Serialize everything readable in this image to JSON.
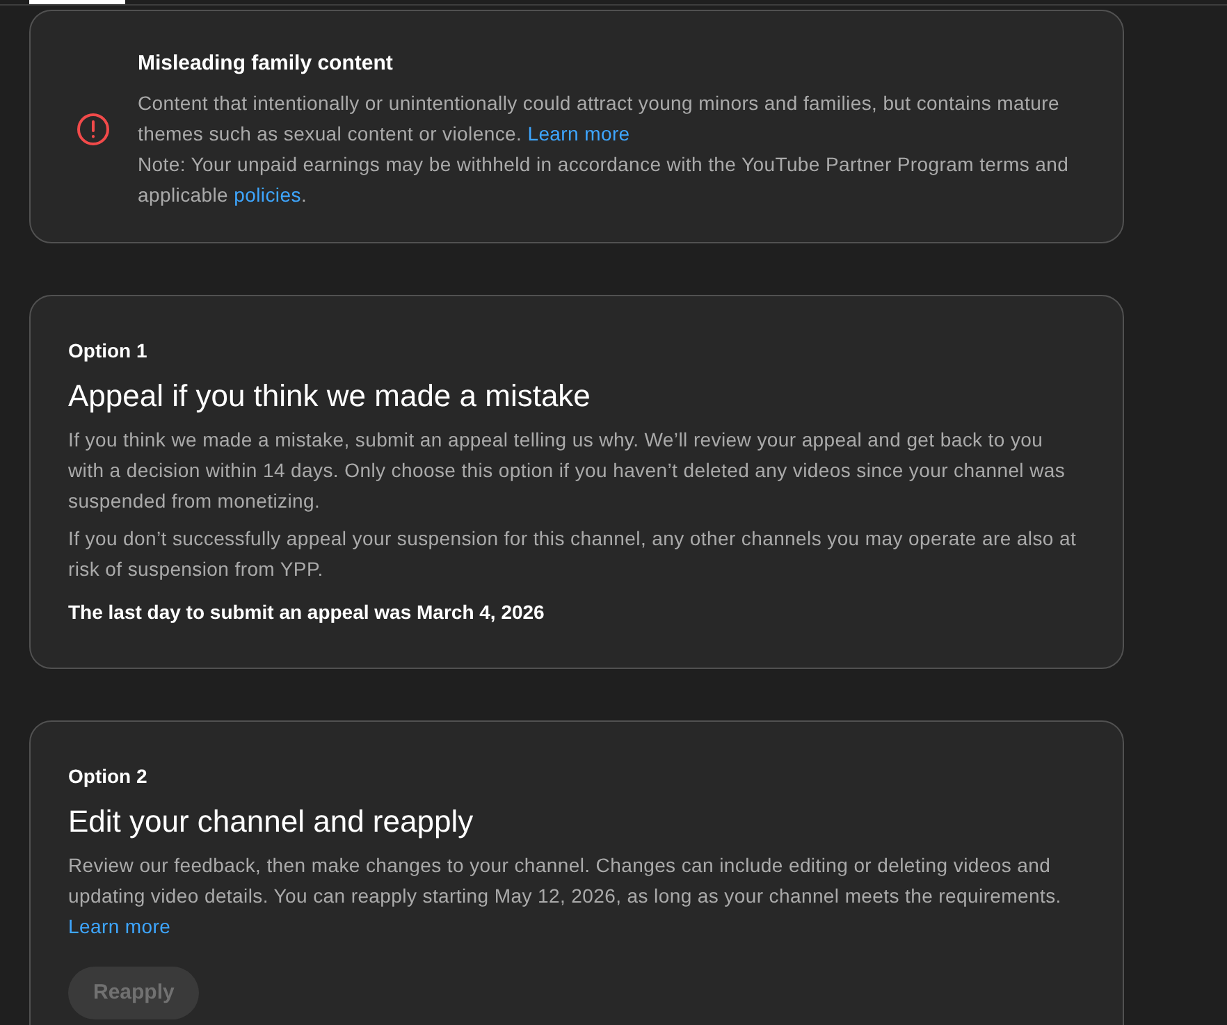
{
  "policy": {
    "title": "Misleading family content",
    "paragraphs": [
      [
        {
          "kind": "text",
          "text": "Content that intentionally or unintentionally could attract young minors and families, but contains mature themes such as sexual content or violence. "
        },
        {
          "kind": "link",
          "text": "Learn more"
        }
      ],
      [
        {
          "kind": "text",
          "text": "Note: Your unpaid earnings may be withheld in accordance with the YouTube Partner Program terms and applicable "
        },
        {
          "kind": "link",
          "text": "policies"
        },
        {
          "kind": "text",
          "text": "."
        }
      ]
    ]
  },
  "options": [
    {
      "label": "Option 1",
      "heading": "Appeal if you think we made a mistake",
      "paragraphs": [
        [
          {
            "kind": "text",
            "text": "If you think we made a mistake, submit an appeal telling us why. We’ll review your appeal and get back to you with a decision within 14 days. Only choose this option if you haven’t deleted any videos since your channel was suspended from monetizing."
          }
        ],
        [
          {
            "kind": "text",
            "text": "If you don’t successfully appeal your suspension for this channel, any other channels you may operate are also at risk of suspension from YPP."
          }
        ]
      ],
      "deadline": "The last day to submit an appeal was March 4, 2026"
    },
    {
      "label": "Option 2",
      "heading": "Edit your channel and reapply",
      "paragraphs": [
        [
          {
            "kind": "text",
            "text": "Review our feedback, then make changes to your channel. Changes can include editing or deleting videos and updating video details. You can reapply starting May 12, 2026, as long as your channel meets the requirements. "
          },
          {
            "kind": "link",
            "text": "Learn more"
          }
        ]
      ],
      "button": {
        "label": "Reapply",
        "disabled": true
      }
    }
  ]
}
